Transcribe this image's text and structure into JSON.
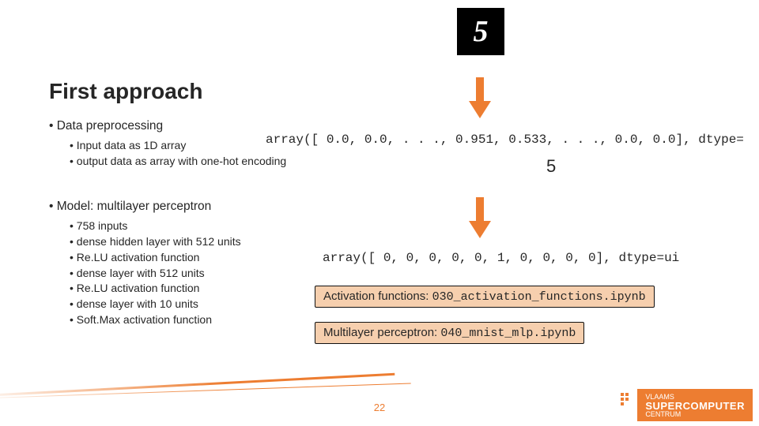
{
  "title": "First approach",
  "digit_glyph": "5",
  "preprocessing": {
    "heading": "Data preprocessing",
    "items": [
      "Input data as 1D array",
      "output data as array with one-hot encoding"
    ]
  },
  "model": {
    "heading": "Model: multilayer perceptron",
    "items": [
      "758 inputs",
      "dense hidden layer with 512 units",
      "Re.LU activation function",
      "dense layer with 512 units",
      "Re.LU activation function",
      "dense layer with 10 units",
      "Soft.Max activation function"
    ]
  },
  "array_top": "array([ 0.0, 0.0, . . ., 0.951, 0.533, . . ., 0.0, 0.0], dtype=",
  "label_value": "5",
  "array_bottom": "array([ 0, 0, 0, 0, 0, 1, 0, 0, 0, 0], dtype=ui",
  "callouts": {
    "activation": {
      "label": "Activation functions:",
      "code": "030_activation_functions.ipynb"
    },
    "mlp": {
      "label": "Multilayer perceptron:",
      "code": "040_mnist_mlp.ipynb"
    }
  },
  "page_number": "22",
  "brand": {
    "top": "VLAAMS",
    "main": "SUPERCOMPUTER",
    "sub": "CENTRUM"
  }
}
